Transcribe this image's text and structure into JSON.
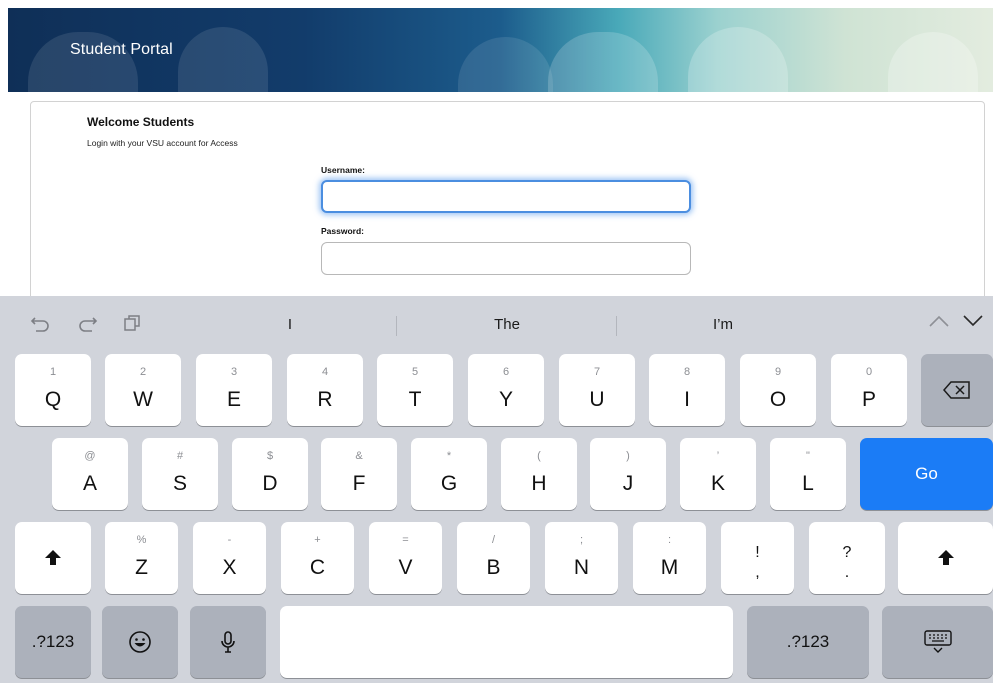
{
  "banner": {
    "title": "Student Portal"
  },
  "login": {
    "welcome_title": "Welcome Students",
    "welcome_sub": "Login with your VSU account for Access",
    "username_label": "Username:",
    "username_value": "",
    "password_label": "Password:",
    "password_value": ""
  },
  "keyboard": {
    "suggestions": [
      "I",
      "The",
      "I’m"
    ],
    "row1": [
      {
        "hint": "1",
        "label": "Q"
      },
      {
        "hint": "2",
        "label": "W"
      },
      {
        "hint": "3",
        "label": "E"
      },
      {
        "hint": "4",
        "label": "R"
      },
      {
        "hint": "5",
        "label": "T"
      },
      {
        "hint": "6",
        "label": "Y"
      },
      {
        "hint": "7",
        "label": "U"
      },
      {
        "hint": "8",
        "label": "I"
      },
      {
        "hint": "9",
        "label": "O"
      },
      {
        "hint": "0",
        "label": "P"
      }
    ],
    "row2": [
      {
        "hint": "@",
        "label": "A"
      },
      {
        "hint": "#",
        "label": "S"
      },
      {
        "hint": "$",
        "label": "D"
      },
      {
        "hint": "&",
        "label": "F"
      },
      {
        "hint": "*",
        "label": "G"
      },
      {
        "hint": "(",
        "label": "H"
      },
      {
        "hint": ")",
        "label": "J"
      },
      {
        "hint": "’",
        "label": "K"
      },
      {
        "hint": "\"",
        "label": "L"
      }
    ],
    "row3": [
      {
        "hint": "%",
        "label": "Z"
      },
      {
        "hint": "-",
        "label": "X"
      },
      {
        "hint": "+",
        "label": "C"
      },
      {
        "hint": "=",
        "label": "V"
      },
      {
        "hint": "/",
        "label": "B"
      },
      {
        "hint": ";",
        "label": "N"
      },
      {
        "hint": ":",
        "label": "M"
      }
    ],
    "punct": [
      {
        "top": "!",
        "bottom": ","
      },
      {
        "top": "?",
        "bottom": "."
      }
    ],
    "go_label": "Go",
    "numbers_label": ".?123",
    "icons": {
      "undo": "undo-icon",
      "redo": "redo-icon",
      "paste": "paste-icon",
      "delete": "delete-icon",
      "shift": "shift-icon",
      "emoji": "emoji-icon",
      "mic": "microphone-icon",
      "dismiss": "keyboard-dismiss-icon"
    }
  }
}
